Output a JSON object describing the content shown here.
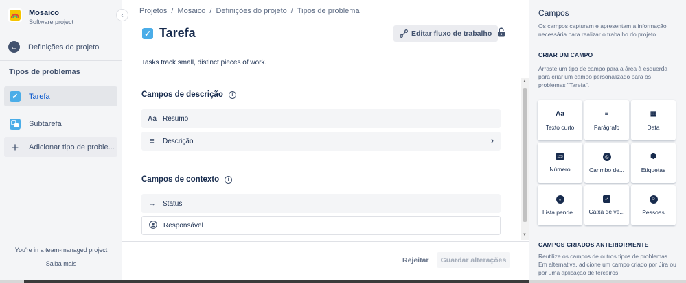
{
  "project": {
    "name": "Mosaico",
    "type": "Software project"
  },
  "sidebar": {
    "back_label": "Definições do projeto",
    "section_title": "Tipos de problemas",
    "items": [
      {
        "label": "Tarefa",
        "color": "#4bade8"
      },
      {
        "label": "Subtarefa",
        "color": "#4bade8"
      },
      {
        "label": "Adicionar tipo de proble..."
      }
    ],
    "footer_text": "You're in a team-managed project",
    "footer_link": "Saiba mais"
  },
  "breadcrumbs": [
    "Projetos",
    "Mosaico",
    "Definições do projeto",
    "Tipos de problema"
  ],
  "breadcrumb_sep": "/",
  "issue_type": {
    "title": "Tarefa",
    "description": "Tasks track small, distinct pieces of work.",
    "workflow_button": "Editar fluxo de trabalho"
  },
  "description_fields": {
    "title": "Campos de descrição",
    "items": [
      "Resumo",
      "Descrição"
    ]
  },
  "context_fields": {
    "title": "Campos de contexto",
    "items": [
      "Status",
      "Responsável"
    ]
  },
  "actions": {
    "reject": "Rejeitar",
    "save": "Guardar alterações"
  },
  "right_panel": {
    "title": "Campos",
    "subtitle": "Os campos capturam e apresentam a informação necessária para realizar o trabalho do projeto.",
    "create_heading": "CRIAR UM CAMPO",
    "create_text": "Arraste um tipo de campo para a área à esquerda para criar um campo personalizado para os problemas \"Tarefa\".",
    "field_types": [
      {
        "label": "Texto curto",
        "icon": "Aa"
      },
      {
        "label": "Parágrafo",
        "icon": "≡"
      },
      {
        "label": "Data",
        "icon": "▦"
      },
      {
        "label": "Número",
        "icon": "123"
      },
      {
        "label": "Carimbo de...",
        "icon": "◷"
      },
      {
        "label": "Etiquetas",
        "icon": "⬢"
      },
      {
        "label": "Lista pende...",
        "icon": "⌄"
      },
      {
        "label": "Caixa de ve...",
        "icon": "✓"
      },
      {
        "label": "Pessoas",
        "icon": "☺"
      }
    ],
    "previous_heading": "CAMPOS CRIADOS ANTERIORMENTE",
    "previous_text": "Reutilize os campos de outros tipos de problemas. Em alternativa, adicione um campo criado por Jira ou por uma aplicação de terceiros."
  }
}
